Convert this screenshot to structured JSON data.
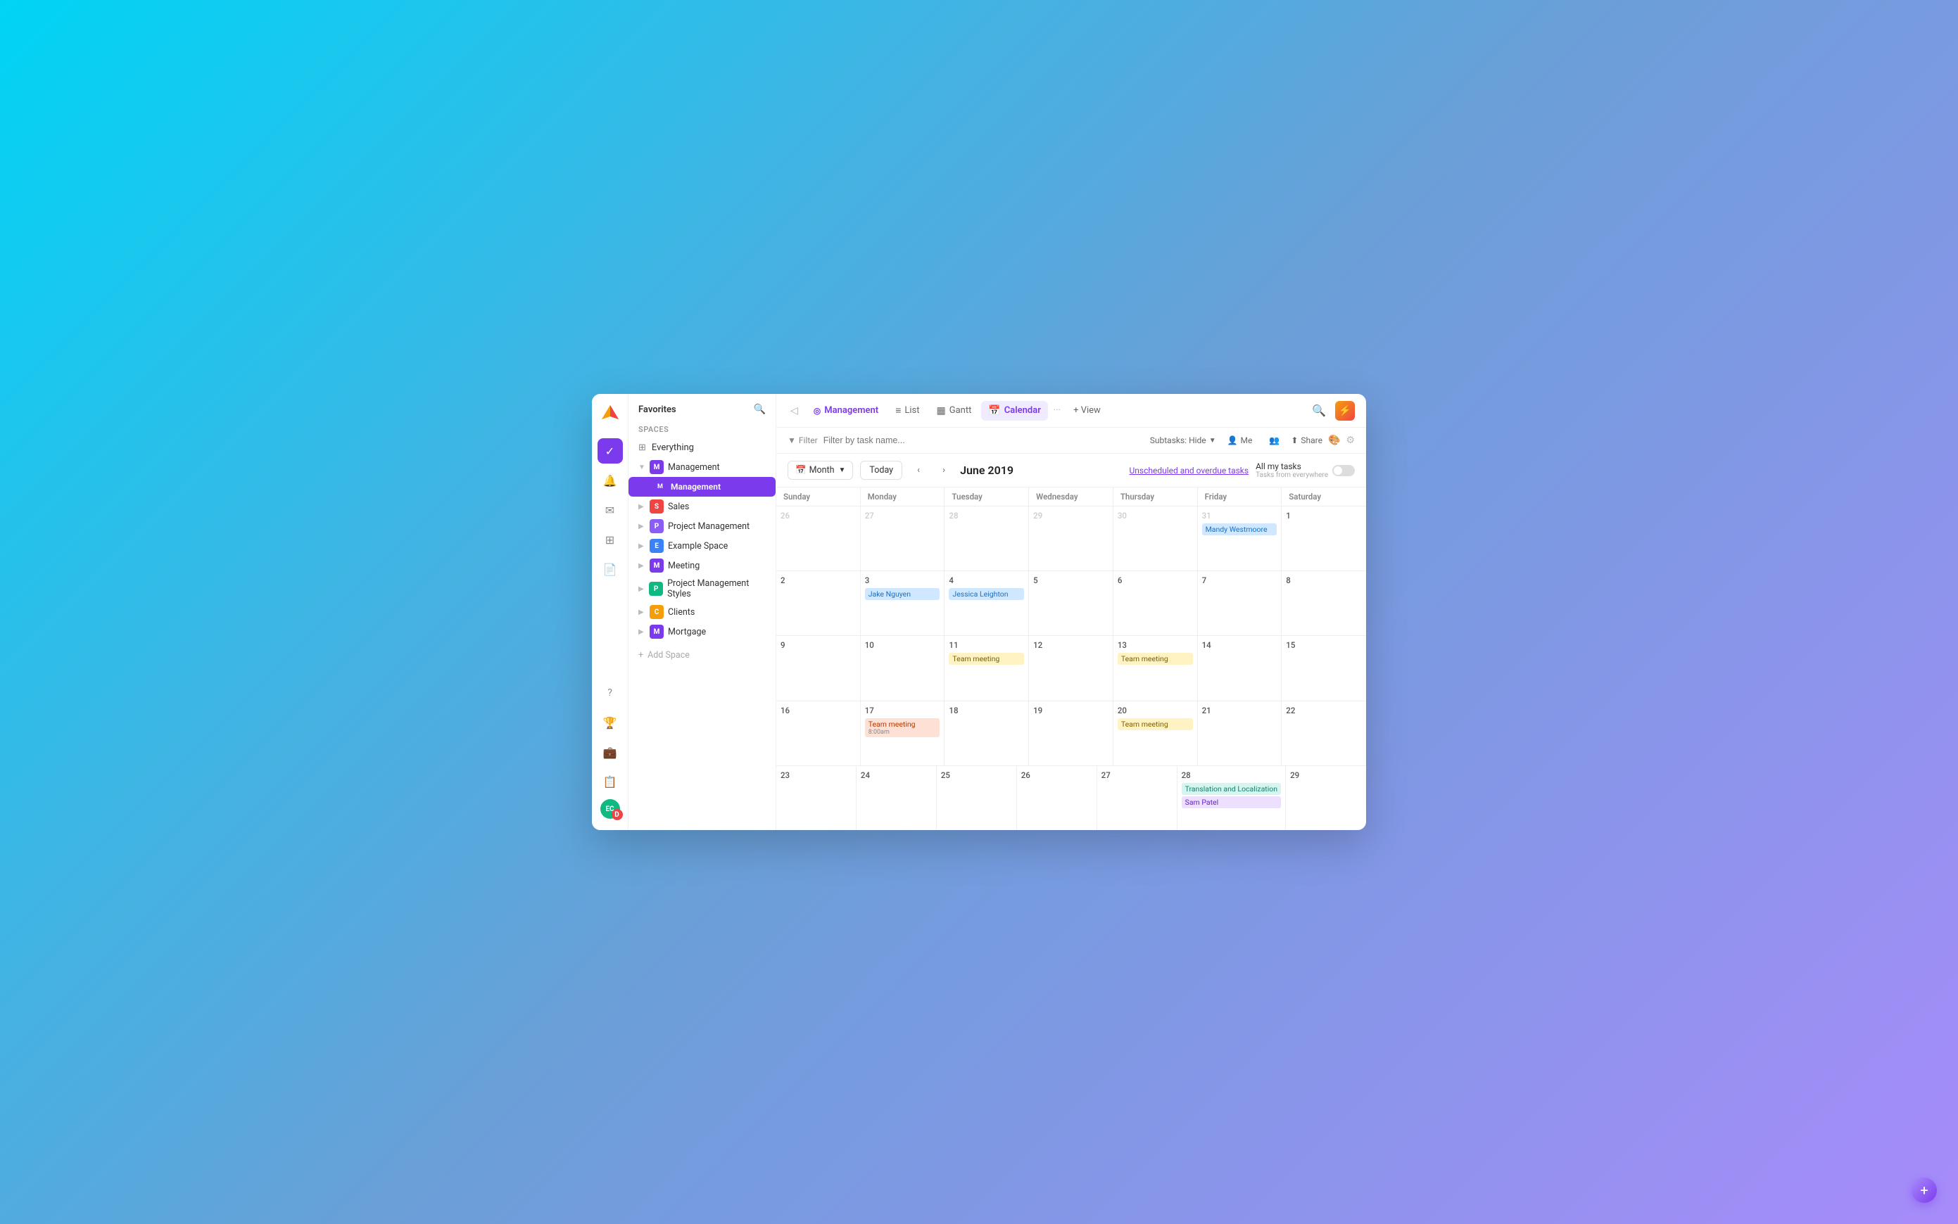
{
  "sidebar": {
    "favorites_label": "Favorites",
    "spaces_label": "Spaces",
    "everything_label": "Everything",
    "spaces": [
      {
        "id": "management",
        "label": "Management",
        "color": "#7c3aed",
        "letter": "M",
        "expanded": true,
        "children": [
          {
            "label": "Management",
            "color": "#7c3aed",
            "letter": "M",
            "active": true
          }
        ]
      },
      {
        "id": "sales",
        "label": "Sales",
        "color": "#ef4444",
        "letter": "S",
        "expanded": false
      },
      {
        "id": "project-mgmt",
        "label": "Project Management",
        "color": "#8b5cf6",
        "letter": "P",
        "expanded": false
      },
      {
        "id": "example",
        "label": "Example Space",
        "color": "#3b82f6",
        "letter": "E",
        "expanded": false
      },
      {
        "id": "meeting",
        "label": "Meeting",
        "color": "#7c3aed",
        "letter": "M",
        "expanded": false
      },
      {
        "id": "pm-styles",
        "label": "Project Management Styles",
        "color": "#10b981",
        "letter": "P",
        "expanded": false
      },
      {
        "id": "clients",
        "label": "Clients",
        "color": "#f59e0b",
        "letter": "C",
        "expanded": false
      },
      {
        "id": "mortgage",
        "label": "Mortgage",
        "color": "#7c3aed",
        "letter": "M",
        "expanded": false
      }
    ],
    "add_space_label": "Add Space"
  },
  "topbar": {
    "active_space": "Management",
    "tabs": [
      {
        "label": "List",
        "icon": "≡",
        "active": false
      },
      {
        "label": "Gantt",
        "icon": "▦",
        "active": false
      },
      {
        "label": "Calendar",
        "icon": "▦",
        "active": true
      }
    ],
    "add_view_label": "+ View"
  },
  "filterbar": {
    "filter_label": "Filter",
    "placeholder": "Filter by task name...",
    "subtasks_label": "Subtasks: Hide",
    "me_label": "Me",
    "share_label": "Share"
  },
  "calendar": {
    "month_label": "Month",
    "today_label": "Today",
    "title": "June 2019",
    "unscheduled_label": "Unscheduled and overdue tasks",
    "all_my_tasks_label": "All my tasks",
    "tasks_from_label": "Tasks from everywhere",
    "days": [
      "Sunday",
      "Monday",
      "Tuesday",
      "Wednesday",
      "Thursday",
      "Friday",
      "Saturday"
    ],
    "weeks": [
      {
        "days": [
          {
            "num": "26",
            "other": true,
            "events": []
          },
          {
            "num": "27",
            "other": true,
            "events": []
          },
          {
            "num": "28",
            "other": true,
            "events": []
          },
          {
            "num": "29",
            "other": true,
            "events": []
          },
          {
            "num": "30",
            "other": true,
            "events": []
          },
          {
            "num": "31",
            "other": true,
            "events": [
              {
                "label": "Mandy Westmoore",
                "type": "blue"
              }
            ]
          },
          {
            "num": "1",
            "other": false,
            "events": []
          }
        ]
      },
      {
        "days": [
          {
            "num": "2",
            "other": false,
            "events": []
          },
          {
            "num": "3",
            "other": false,
            "events": [
              {
                "label": "Jake Nguyen",
                "type": "blue"
              }
            ]
          },
          {
            "num": "4",
            "other": false,
            "events": [
              {
                "label": "Jessica Leighton",
                "type": "blue"
              }
            ]
          },
          {
            "num": "5",
            "other": false,
            "events": []
          },
          {
            "num": "6",
            "other": false,
            "events": []
          },
          {
            "num": "7",
            "other": false,
            "events": []
          },
          {
            "num": "8",
            "other": false,
            "events": []
          }
        ]
      },
      {
        "days": [
          {
            "num": "9",
            "other": false,
            "events": []
          },
          {
            "num": "10",
            "other": false,
            "events": []
          },
          {
            "num": "11",
            "other": false,
            "events": [
              {
                "label": "Team meeting",
                "type": "yellow"
              }
            ]
          },
          {
            "num": "12",
            "other": false,
            "events": []
          },
          {
            "num": "13",
            "other": false,
            "events": [
              {
                "label": "Team meeting",
                "type": "yellow"
              }
            ]
          },
          {
            "num": "14",
            "other": false,
            "events": []
          },
          {
            "num": "15",
            "other": false,
            "events": []
          }
        ]
      },
      {
        "days": [
          {
            "num": "16",
            "other": false,
            "events": []
          },
          {
            "num": "17",
            "other": false,
            "events": [
              {
                "label": "Team meeting",
                "type": "red",
                "time": "8:00am"
              }
            ]
          },
          {
            "num": "18",
            "other": false,
            "events": []
          },
          {
            "num": "19",
            "other": false,
            "events": []
          },
          {
            "num": "20",
            "other": false,
            "events": [
              {
                "label": "Team meeting",
                "type": "yellow"
              }
            ]
          },
          {
            "num": "21",
            "other": false,
            "events": []
          },
          {
            "num": "22",
            "other": false,
            "events": []
          }
        ]
      },
      {
        "days": [
          {
            "num": "23",
            "other": false,
            "events": []
          },
          {
            "num": "24",
            "other": false,
            "events": []
          },
          {
            "num": "25",
            "other": false,
            "events": []
          },
          {
            "num": "26",
            "other": false,
            "events": []
          },
          {
            "num": "27",
            "other": false,
            "events": []
          },
          {
            "num": "28",
            "other": false,
            "events": [
              {
                "label": "Translation and Localization",
                "type": "teal"
              },
              {
                "label": "Sam Patel",
                "type": "purple"
              }
            ]
          },
          {
            "num": "29",
            "other": false,
            "events": []
          }
        ]
      }
    ]
  }
}
